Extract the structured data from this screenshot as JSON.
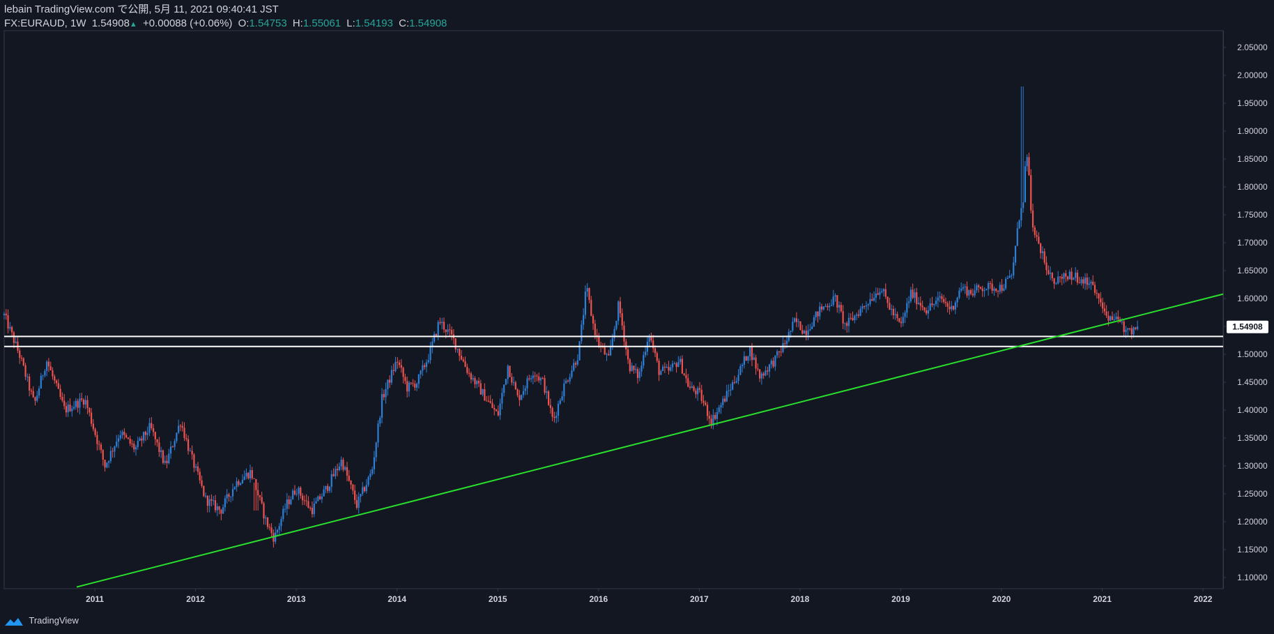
{
  "header": {
    "line1": "lebain TradingView.com で公開, 5月 11, 2021 09:40:41 JST",
    "symbol": "FX:EURAUD, 1W",
    "last": "1.54908",
    "arrow": "▲",
    "change": "+0.00088 (+0.06%)",
    "o_label": "O:",
    "o_val": "1.54753",
    "h_label": "H:",
    "h_val": "1.55061",
    "l_label": "L:",
    "l_val": "1.54193",
    "c_label": "C:",
    "c_val": "1.54908"
  },
  "footer": {
    "brand": "TradingView",
    "logo_icon": "tradingview-logo-icon"
  },
  "colors": {
    "background": "#131722",
    "up": "#2e7fd6",
    "down": "#ef5350",
    "trendline": "#29e02c",
    "level": "#ffffff",
    "price_tag_bg": "#ffffff",
    "price_tag_text": "#131722",
    "axis_text": "#d1d4dc",
    "border": "#363a45"
  },
  "chart_data": {
    "type": "candlestick",
    "symbol": "FX:EURAUD",
    "interval": "1W",
    "ylim": [
      1.08,
      2.08
    ],
    "xlim": [
      2010.1,
      2022.2
    ],
    "yticks": [
      "2.05000",
      "2.00000",
      "1.95000",
      "1.90000",
      "1.85000",
      "1.80000",
      "1.75000",
      "1.70000",
      "1.65000",
      "1.60000",
      "1.55000",
      "1.50000",
      "1.45000",
      "1.40000",
      "1.35000",
      "1.30000",
      "1.25000",
      "1.20000",
      "1.15000",
      "1.10000"
    ],
    "xticks": [
      "2011",
      "2012",
      "2013",
      "2014",
      "2015",
      "2016",
      "2017",
      "2018",
      "2019",
      "2020",
      "2021",
      "2022"
    ],
    "last_price": "1.54908",
    "path": [
      [
        2010.1,
        1.57
      ],
      [
        2010.25,
        1.5
      ],
      [
        2010.4,
        1.41
      ],
      [
        2010.52,
        1.49
      ],
      [
        2010.7,
        1.4
      ],
      [
        2010.9,
        1.42
      ],
      [
        2011.0,
        1.36
      ],
      [
        2011.1,
        1.3
      ],
      [
        2011.25,
        1.36
      ],
      [
        2011.4,
        1.33
      ],
      [
        2011.55,
        1.37
      ],
      [
        2011.7,
        1.3
      ],
      [
        2011.85,
        1.38
      ],
      [
        2011.95,
        1.32
      ],
      [
        2012.1,
        1.24
      ],
      [
        2012.25,
        1.22
      ],
      [
        2012.4,
        1.27
      ],
      [
        2012.55,
        1.29
      ],
      [
        2012.7,
        1.2
      ],
      [
        2012.78,
        1.17
      ],
      [
        2012.9,
        1.23
      ],
      [
        2013.0,
        1.26
      ],
      [
        2013.15,
        1.22
      ],
      [
        2013.3,
        1.26
      ],
      [
        2013.45,
        1.31
      ],
      [
        2013.6,
        1.23
      ],
      [
        2013.75,
        1.29
      ],
      [
        2013.85,
        1.42
      ],
      [
        2014.0,
        1.49
      ],
      [
        2014.1,
        1.44
      ],
      [
        2014.2,
        1.45
      ],
      [
        2014.32,
        1.5
      ],
      [
        2014.42,
        1.56
      ],
      [
        2014.55,
        1.53
      ],
      [
        2014.7,
        1.47
      ],
      [
        2014.85,
        1.43
      ],
      [
        2015.0,
        1.39
      ],
      [
        2015.1,
        1.48
      ],
      [
        2015.2,
        1.42
      ],
      [
        2015.35,
        1.47
      ],
      [
        2015.45,
        1.45
      ],
      [
        2015.55,
        1.38
      ],
      [
        2015.65,
        1.44
      ],
      [
        2015.8,
        1.5
      ],
      [
        2015.88,
        1.62
      ],
      [
        2015.95,
        1.55
      ],
      [
        2016.0,
        1.52
      ],
      [
        2016.1,
        1.49
      ],
      [
        2016.2,
        1.59
      ],
      [
        2016.3,
        1.48
      ],
      [
        2016.4,
        1.46
      ],
      [
        2016.5,
        1.54
      ],
      [
        2016.6,
        1.47
      ],
      [
        2016.7,
        1.47
      ],
      [
        2016.8,
        1.49
      ],
      [
        2016.9,
        1.44
      ],
      [
        2017.0,
        1.43
      ],
      [
        2017.12,
        1.38
      ],
      [
        2017.25,
        1.42
      ],
      [
        2017.4,
        1.47
      ],
      [
        2017.5,
        1.51
      ],
      [
        2017.6,
        1.46
      ],
      [
        2017.75,
        1.49
      ],
      [
        2017.85,
        1.52
      ],
      [
        2017.95,
        1.56
      ],
      [
        2018.05,
        1.54
      ],
      [
        2018.2,
        1.58
      ],
      [
        2018.35,
        1.6
      ],
      [
        2018.45,
        1.55
      ],
      [
        2018.55,
        1.57
      ],
      [
        2018.7,
        1.6
      ],
      [
        2018.8,
        1.62
      ],
      [
        2018.9,
        1.58
      ],
      [
        2019.0,
        1.55
      ],
      [
        2019.1,
        1.61
      ],
      [
        2019.25,
        1.58
      ],
      [
        2019.4,
        1.6
      ],
      [
        2019.5,
        1.58
      ],
      [
        2019.6,
        1.62
      ],
      [
        2019.7,
        1.61
      ],
      [
        2019.8,
        1.62
      ],
      [
        2019.9,
        1.62
      ],
      [
        2020.0,
        1.62
      ],
      [
        2020.1,
        1.64
      ],
      [
        2020.18,
        1.75
      ],
      [
        2020.25,
        1.83
      ],
      [
        2020.32,
        1.72
      ],
      [
        2020.42,
        1.67
      ],
      [
        2020.52,
        1.63
      ],
      [
        2020.62,
        1.64
      ],
      [
        2020.72,
        1.64
      ],
      [
        2020.85,
        1.63
      ],
      [
        2020.95,
        1.61
      ],
      [
        2021.05,
        1.57
      ],
      [
        2021.15,
        1.56
      ],
      [
        2021.25,
        1.54
      ],
      [
        2021.35,
        1.55
      ]
    ],
    "horizontal_levels": [
      1.532,
      1.514
    ],
    "trendline": {
      "p1": [
        2010.82,
        1.083
      ],
      "p2": [
        2022.2,
        1.608
      ]
    }
  }
}
